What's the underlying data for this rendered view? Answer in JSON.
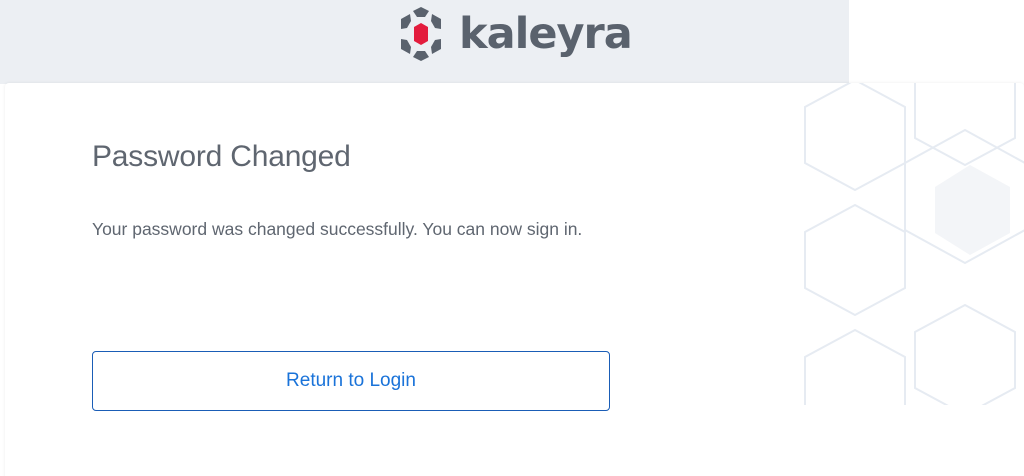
{
  "header": {
    "brand_name": "kaleyra",
    "logo_icon": "kaleyra-hex-logo-icon"
  },
  "card": {
    "title": "Password Changed",
    "message": "Your password was changed successfully. You can now sign in.",
    "decoration_icon": "hexagon-pattern-icon",
    "return_button_label": "Return to Login"
  },
  "colors": {
    "header_background": "#eceff3",
    "text": "#5f6670",
    "brand_text": "#5a626d",
    "logo_accent": "#e31c3d",
    "button_border": "#1a5db6",
    "button_text": "#1a73d9"
  }
}
